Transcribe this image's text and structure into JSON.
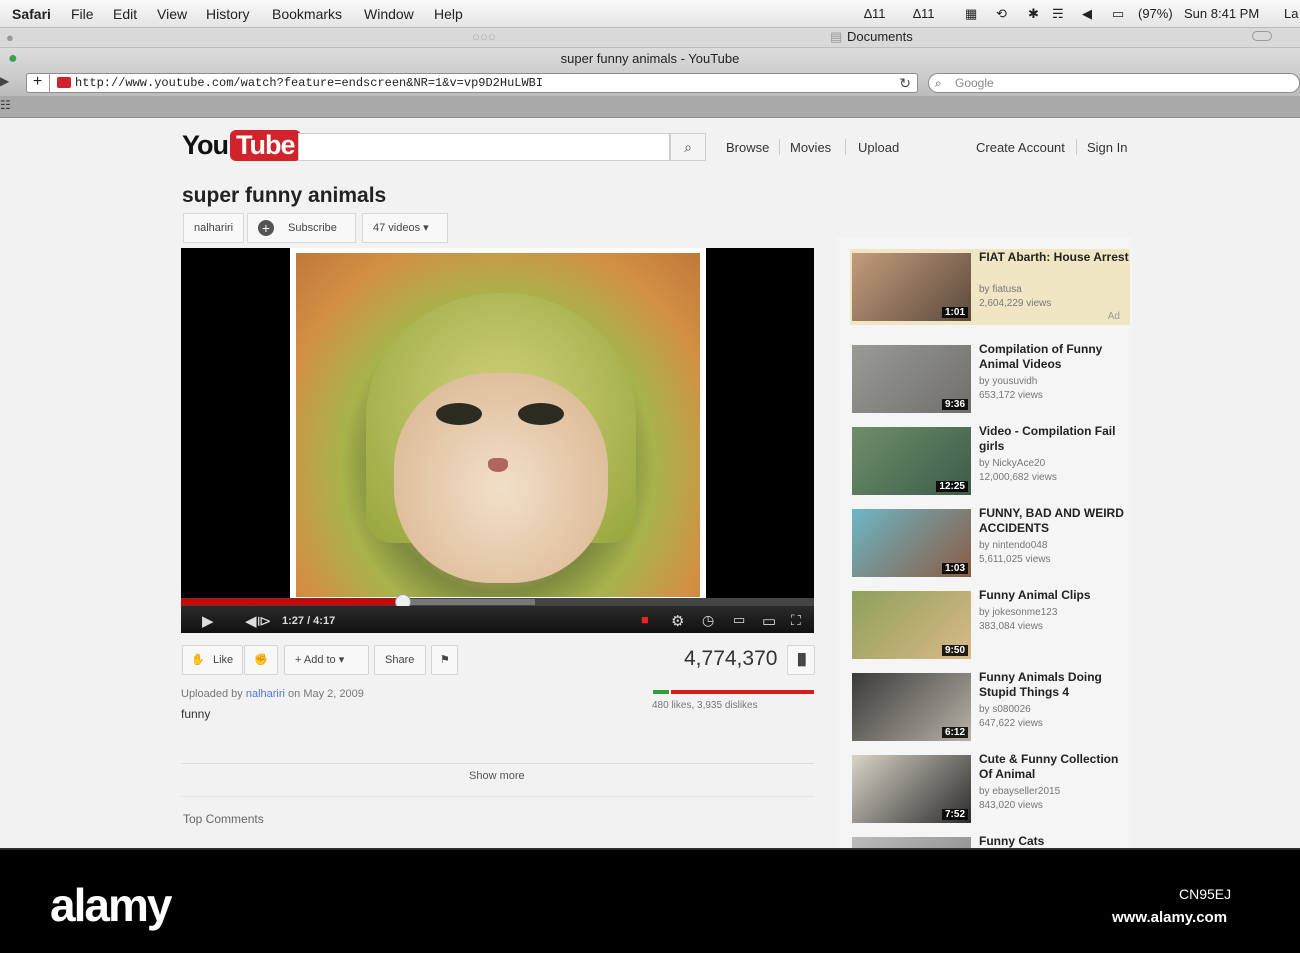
{
  "menubar": {
    "app": "Safari",
    "items": [
      "File",
      "Edit",
      "View",
      "History",
      "Bookmarks",
      "Window",
      "Help"
    ],
    "status": {
      "num1": "11",
      "num2": "11",
      "battery": "(97%)",
      "clock": "Sun 8:41 PM",
      "truncated": "La"
    }
  },
  "chrome": {
    "folder_label": "Documents",
    "window_title": "super funny animals - YouTube",
    "url": "http://www.youtube.com/watch?feature=endscreen&NR=1&v=vp9D2HuLWBI",
    "search_placeholder": "Google",
    "add_label": "+"
  },
  "youtube": {
    "logo_you": "You",
    "logo_tube": "Tube",
    "nav": {
      "browse": "Browse",
      "movies": "Movies",
      "upload": "Upload",
      "create": "Create Account",
      "signin": "Sign In"
    },
    "title": "super funny animals",
    "channel": "nalhariri",
    "subscribe": "Subscribe",
    "videos": "47 videos",
    "player": {
      "time": "1:27 / 4:17",
      "progress": 0.35,
      "buffered": 0.56
    },
    "actions": {
      "like": "Like",
      "add_to": "Add to",
      "share": "Share"
    },
    "views": "4,774,370",
    "likes_dislikes": "480 likes, 3,935 dislikes",
    "uploaded_prefix": "Uploaded by",
    "uploaded_user": "nalhariri",
    "uploaded_suffix": "on May 2, 2009",
    "description": "funny",
    "show_more": "Show more",
    "top_comments": "Top Comments"
  },
  "related": [
    {
      "title": "FIAT Abarth: House Arrest",
      "by": "by fiatusa",
      "views": "2,604,229 views",
      "dur": "1:01",
      "ad": "Ad",
      "color1": "#c49c7c",
      "color2": "#5b4a3c"
    },
    {
      "title": "Compilation of Funny Animal Videos",
      "by": "by yousuvidh",
      "views": "653,172 views",
      "dur": "9:36",
      "color1": "#9a9a96",
      "color2": "#6f6e6a"
    },
    {
      "title": "Video - Compilation Fail girls",
      "by": "by NickyAce20",
      "views": "12,000,682 views",
      "dur": "12:25",
      "color1": "#6f8f6a",
      "color2": "#3c5b4a"
    },
    {
      "title": "FUNNY, BAD AND WEIRD ACCIDENTS",
      "by": "by nintendo048",
      "views": "5,611,025 views",
      "dur": "1:03",
      "color1": "#6db7c4",
      "color2": "#8a5b45"
    },
    {
      "title": "Funny Animal Clips",
      "by": "by jokesonme123",
      "views": "383,084 views",
      "dur": "9:50",
      "color1": "#8fa05a",
      "color2": "#d9b98a"
    },
    {
      "title": "Funny Animals Doing Stupid Things 4",
      "by": "by s080026",
      "views": "647,622 views",
      "dur": "6:12",
      "color1": "#3a3a3a",
      "color2": "#b8b2a6"
    },
    {
      "title": "Cute & Funny Collection Of Animal",
      "by": "by ebayseller2015",
      "views": "843,020 views",
      "dur": "7:52",
      "color1": "#d9d4c8",
      "color2": "#2b2b2b"
    },
    {
      "title": "Funny Cats",
      "by": "",
      "views": "",
      "dur": "",
      "color1": "#bbbbbb",
      "color2": "#888888"
    }
  ],
  "watermark": {
    "brand": "alamy",
    "image_id": "CN95EJ",
    "url": "www.alamy.com"
  }
}
